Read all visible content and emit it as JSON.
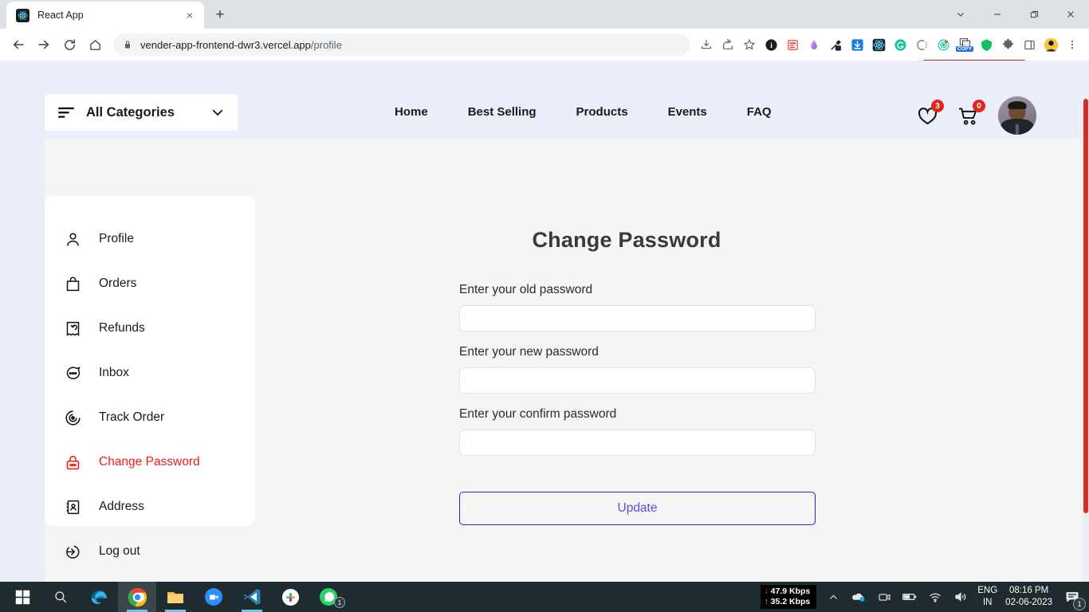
{
  "browser": {
    "tab": {
      "title": "React App",
      "favicon": "react-icon",
      "close_label": "×"
    },
    "new_tab_label": "+",
    "window_controls": {
      "tab_search": "tab-search-icon",
      "minimize": "—",
      "maximize": "❐",
      "close": "✕"
    },
    "nav": {
      "back": "back-icon",
      "forward": "forward-icon",
      "reload": "reload-icon",
      "home": "home-icon"
    },
    "omnibox": {
      "lock": "lock-icon",
      "url_host": "vender-app-frontend-dwr3.vercel.app",
      "url_path": "/profile",
      "install": "install-icon",
      "share": "share-icon",
      "bookmark": "star-icon"
    },
    "extensions": [
      {
        "name": "bitwarden-icon",
        "color": "#1d1d1d"
      },
      {
        "name": "notes-icon",
        "color": "#e8443a"
      },
      {
        "name": "gradient-icon",
        "color": "#a55ff0"
      },
      {
        "name": "eyedropper-icon",
        "color": "#1b2440"
      },
      {
        "name": "download-manager-icon",
        "color": "#1b7fe0"
      },
      {
        "name": "react-devtools-icon",
        "color": "#1d2430"
      },
      {
        "name": "grammarly-icon",
        "color": "#15c39a"
      },
      {
        "name": "clockify-icon",
        "color": "#7a8288"
      },
      {
        "name": "screen-recorder-icon",
        "color": "#14c2a0"
      },
      {
        "name": "copy-extension-icon",
        "color": "#1a73e8",
        "label": "COPY"
      },
      {
        "name": "shield-icon",
        "color": "#0fbf61"
      },
      {
        "name": "puzzle-icon",
        "color": "#5f6368"
      },
      {
        "name": "sidepanel-icon",
        "color": "#5f6368"
      },
      {
        "name": "profile-avatar-icon",
        "color": "#f5c542"
      },
      {
        "name": "kebab-menu-icon",
        "color": "#5f6368"
      }
    ]
  },
  "site": {
    "categories_button": {
      "label": "All Categories",
      "menu_icon": "hamburger-icon",
      "chevron": "chevron-down-icon"
    },
    "nav_links": [
      {
        "label": "Home"
      },
      {
        "label": "Best Selling"
      },
      {
        "label": "Products"
      },
      {
        "label": "Events"
      },
      {
        "label": "FAQ"
      }
    ],
    "wishlist": {
      "icon": "heart-icon",
      "count": "3"
    },
    "cart": {
      "icon": "cart-icon",
      "count": "0"
    },
    "avatar": {
      "name": "user-avatar"
    }
  },
  "sidebar": {
    "items": [
      {
        "label": "Profile",
        "icon": "user-icon",
        "active": false
      },
      {
        "label": "Orders",
        "icon": "bag-icon",
        "active": false
      },
      {
        "label": "Refunds",
        "icon": "refund-icon",
        "active": false
      },
      {
        "label": "Inbox",
        "icon": "chat-icon",
        "active": false
      },
      {
        "label": "Track Order",
        "icon": "target-icon",
        "active": false
      },
      {
        "label": "Change Password",
        "icon": "lock-icon",
        "active": true
      },
      {
        "label": "Address",
        "icon": "address-book-icon",
        "active": false
      },
      {
        "label": "Log out",
        "icon": "logout-icon",
        "active": false
      }
    ],
    "active_color": "#f21b1b"
  },
  "main": {
    "title": "Change Password",
    "fields": [
      {
        "label": "Enter your old password",
        "value": "",
        "placeholder": ""
      },
      {
        "label": "Enter your new password",
        "value": "",
        "placeholder": ""
      },
      {
        "label": "Enter your confirm password",
        "value": "",
        "placeholder": ""
      }
    ],
    "submit_label": "Update",
    "submit_border_color": "#3421b8",
    "submit_text_color": "#5b4ce0"
  },
  "taskbar": {
    "apps": [
      {
        "name": "start-button",
        "state": "idle"
      },
      {
        "name": "search-icon",
        "state": "idle"
      },
      {
        "name": "edge-icon",
        "state": "idle"
      },
      {
        "name": "chrome-icon",
        "state": "active"
      },
      {
        "name": "file-explorer-icon",
        "state": "running"
      },
      {
        "name": "zoom-icon",
        "state": "idle"
      },
      {
        "name": "vscode-icon",
        "state": "running"
      },
      {
        "name": "slack-icon",
        "state": "idle"
      },
      {
        "name": "whatsapp-icon",
        "state": "idle",
        "badge": "1"
      }
    ],
    "network": {
      "down": "47.9 Kbps",
      "up": "35.2 Kbps",
      "down_arrow": "↓",
      "up_arrow": "↑"
    },
    "tray_icons": [
      {
        "name": "show-hidden-icons-chevron"
      },
      {
        "name": "onedrive-icon"
      },
      {
        "name": "camera-icon"
      },
      {
        "name": "battery-icon"
      },
      {
        "name": "wifi-icon"
      },
      {
        "name": "volume-icon"
      }
    ],
    "language": {
      "line1": "ENG",
      "line2": "IN"
    },
    "clock": {
      "time": "08:16 PM",
      "date": "02-06-2023"
    },
    "notifications": {
      "icon": "notification-icon",
      "count": "1"
    }
  }
}
